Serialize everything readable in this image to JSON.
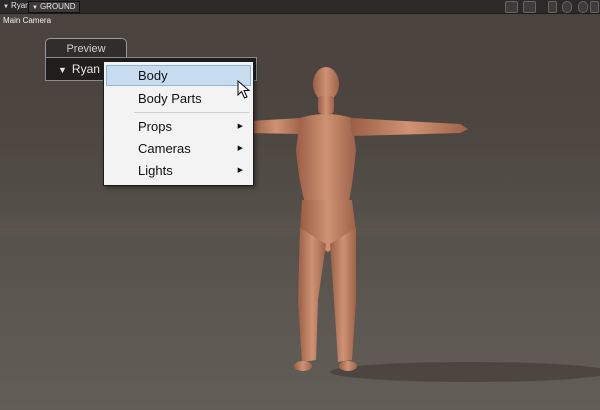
{
  "toolbar": {
    "figure_selector": "Ryan",
    "ground_selector": "GROUND"
  },
  "viewport": {
    "camera_label": "Main Camera"
  },
  "preview_panel": {
    "tab_label": "Preview",
    "figure_name": "Ryan"
  },
  "context_menu": {
    "items": [
      {
        "label": "Body",
        "highlighted": true,
        "has_submenu": false
      },
      {
        "label": "Body Parts",
        "highlighted": false,
        "has_submenu": false
      },
      {
        "label": "Props",
        "highlighted": false,
        "has_submenu": true
      },
      {
        "label": "Cameras",
        "highlighted": false,
        "has_submenu": true
      },
      {
        "label": "Lights",
        "highlighted": false,
        "has_submenu": true
      }
    ]
  },
  "colors": {
    "menu_highlight": "#c8dcf0",
    "skin": "#c98d70"
  }
}
